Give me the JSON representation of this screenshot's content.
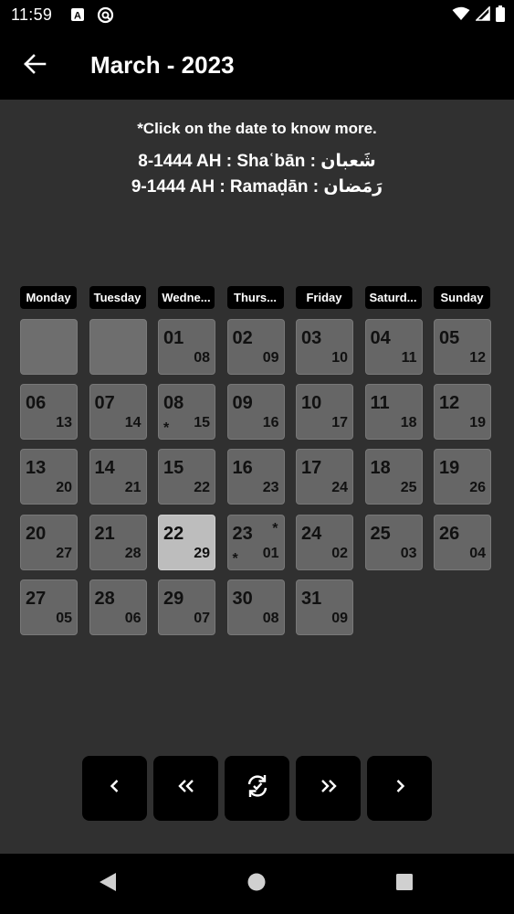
{
  "status_bar": {
    "time": "11:59",
    "left_icons": [
      "a-box-icon",
      "at-sign-icon"
    ],
    "right_icons": [
      "wifi-icon",
      "signal-icon",
      "battery-icon"
    ]
  },
  "app_bar": {
    "title": "March - 2023",
    "back_icon": "arrow-left-icon"
  },
  "info": {
    "hint": "*Click on the date to know more.",
    "line1": "8-1444 AH : Shaʿbān : شَعبان",
    "line2": "9-1444 AH : Ramaḍān : رَمَضان"
  },
  "weekdays": [
    "Monday",
    "Tuesday",
    "Wedne...",
    "Thurs...",
    "Friday",
    "Saturd...",
    "Sunday"
  ],
  "days": [
    {
      "empty": true
    },
    {
      "empty": true
    },
    {
      "day": "01",
      "hijri": "08"
    },
    {
      "day": "02",
      "hijri": "09"
    },
    {
      "day": "03",
      "hijri": "10"
    },
    {
      "day": "04",
      "hijri": "11"
    },
    {
      "day": "05",
      "hijri": "12"
    },
    {
      "day": "06",
      "hijri": "13"
    },
    {
      "day": "07",
      "hijri": "14"
    },
    {
      "day": "08",
      "hijri": "15",
      "mark_bottom": "*"
    },
    {
      "day": "09",
      "hijri": "16"
    },
    {
      "day": "10",
      "hijri": "17"
    },
    {
      "day": "11",
      "hijri": "18"
    },
    {
      "day": "12",
      "hijri": "19"
    },
    {
      "day": "13",
      "hijri": "20"
    },
    {
      "day": "14",
      "hijri": "21"
    },
    {
      "day": "15",
      "hijri": "22"
    },
    {
      "day": "16",
      "hijri": "23"
    },
    {
      "day": "17",
      "hijri": "24"
    },
    {
      "day": "18",
      "hijri": "25"
    },
    {
      "day": "19",
      "hijri": "26"
    },
    {
      "day": "20",
      "hijri": "27"
    },
    {
      "day": "21",
      "hijri": "28"
    },
    {
      "day": "22",
      "hijri": "29",
      "today": true
    },
    {
      "day": "23",
      "hijri": "01",
      "mark_top": "*",
      "mark_bottom": "*"
    },
    {
      "day": "24",
      "hijri": "02"
    },
    {
      "day": "25",
      "hijri": "03"
    },
    {
      "day": "26",
      "hijri": "04"
    },
    {
      "day": "27",
      "hijri": "05"
    },
    {
      "day": "28",
      "hijri": "06"
    },
    {
      "day": "29",
      "hijri": "07"
    },
    {
      "day": "30",
      "hijri": "08"
    },
    {
      "day": "31",
      "hijri": "09"
    }
  ],
  "nav_buttons": [
    "chevron-left-icon",
    "double-chevron-left-icon",
    "refresh-icon",
    "double-chevron-right-icon",
    "chevron-right-icon"
  ],
  "system_nav": [
    "back-triangle-icon",
    "home-circle-icon",
    "recents-square-icon"
  ],
  "colors": {
    "background": "#303030",
    "bar": "#000000",
    "cell": "#666666",
    "cell_today": "#bdbdbd",
    "cell_text": "#111111"
  }
}
